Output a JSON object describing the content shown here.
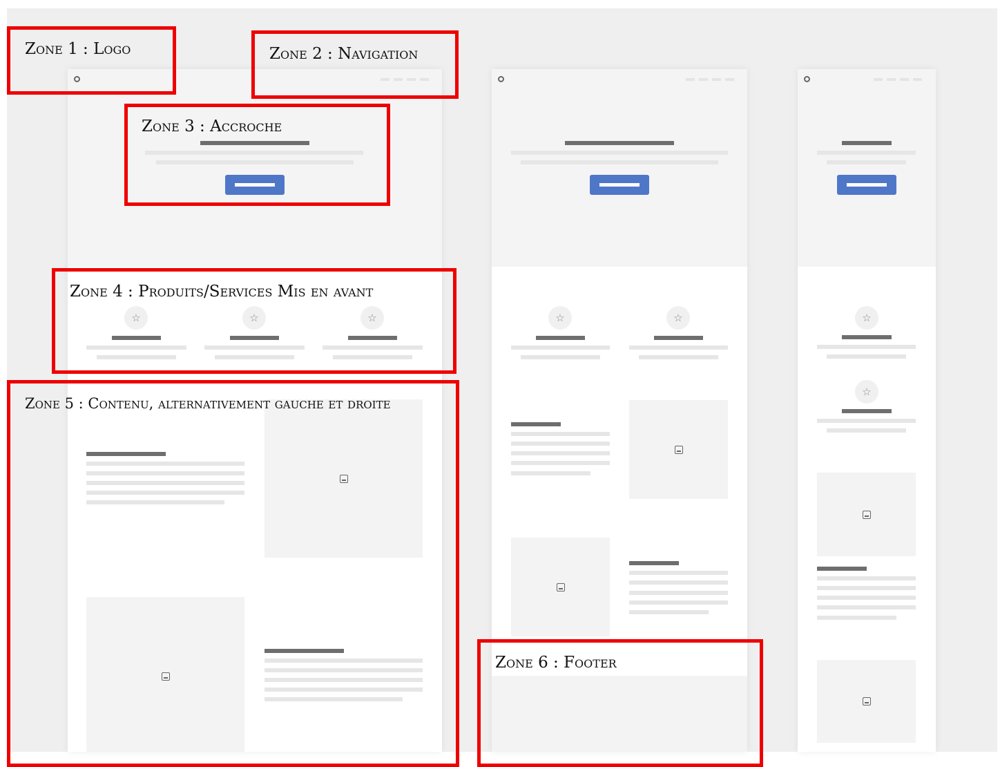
{
  "zones": [
    {
      "number": "1",
      "label": "Zone 1 : Logo"
    },
    {
      "number": "2",
      "label": "Zone 2 : Navigation"
    },
    {
      "number": "3",
      "label": "Zone 3 : Accroche"
    },
    {
      "number": "4",
      "label": "Zone 4 : Produits/Services Mis en avant"
    },
    {
      "number": "5",
      "label": "Zone 5 : Contenu, alternativement gauche et droite"
    },
    {
      "number": "6",
      "label": "Zone 6 : Footer"
    }
  ],
  "mockups": [
    "desktop",
    "tablet",
    "mobile"
  ],
  "colors": {
    "zone_border": "#ee0000",
    "cta_button": "#4f77c8",
    "heading_bar": "#6e6e6e",
    "text_bar": "#e6e6e6",
    "hero_background": "#f4f4f5",
    "page_background": "#efefef"
  },
  "icons": {
    "logo": "circle-logo-icon",
    "feature": "star-icon",
    "image": "image-placeholder-icon"
  }
}
